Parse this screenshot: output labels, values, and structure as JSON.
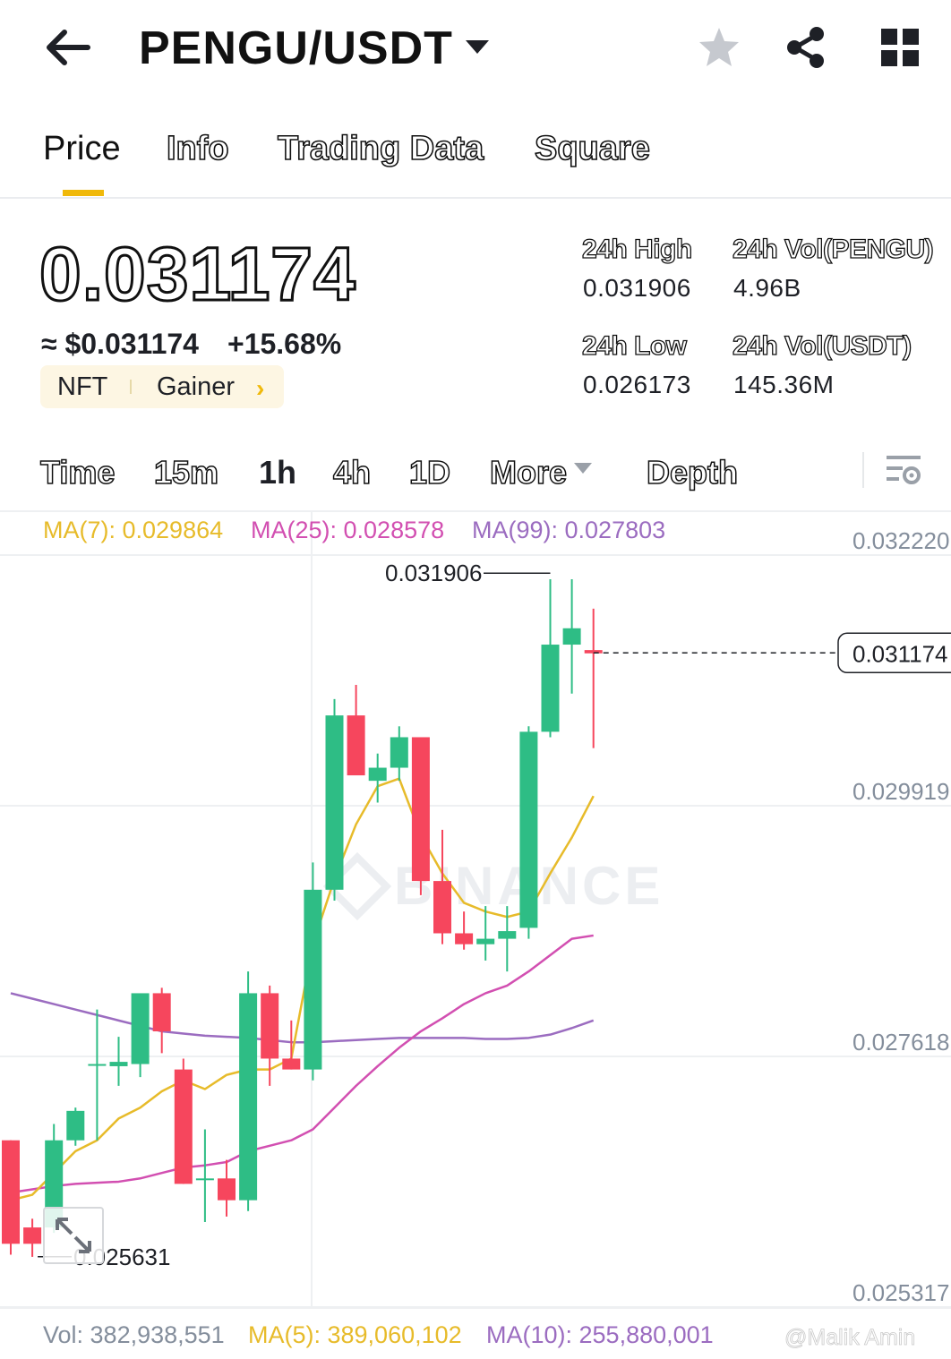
{
  "header": {
    "pair": "PENGU/USDT",
    "icons": [
      "back-arrow-icon",
      "caret-down-icon",
      "star-icon",
      "share-icon",
      "grid-icon"
    ]
  },
  "tabs": [
    {
      "label": "Price",
      "active": true
    },
    {
      "label": "Info",
      "active": false
    },
    {
      "label": "Trading Data",
      "active": false
    },
    {
      "label": "Square",
      "active": false
    }
  ],
  "price": {
    "last": "0.031174",
    "usd": "≈ $0.031174",
    "change": "+15.68%",
    "tags": {
      "first": "NFT",
      "second": "Gainer"
    }
  },
  "stats": {
    "high_label": "24h High",
    "high_value": "0.031906",
    "low_label": "24h Low",
    "low_value": "0.026173",
    "vol_base_label": "24h Vol(PENGU)",
    "vol_base_value": "4.96B",
    "vol_quote_label": "24h Vol(USDT)",
    "vol_quote_value": "145.36M"
  },
  "intervals": {
    "time": "Time",
    "m15": "15m",
    "h1": "1h",
    "h4": "4h",
    "d1": "1D",
    "more": "More",
    "depth": "Depth",
    "active": "1h"
  },
  "ma": {
    "ma7": "MA(7): 0.029864",
    "ma25": "MA(25): 0.028578",
    "ma99": "MA(99): 0.027803"
  },
  "chart_labels": {
    "y_ticks": [
      "0.032220",
      "0.029919",
      "0.027618",
      "0.025317"
    ],
    "current_price": "0.031174",
    "high_marker": "0.031906",
    "low_marker": "0.025631",
    "watermark": "BINANCE"
  },
  "volume": {
    "vol": "Vol: 382,938,551",
    "ma5": "MA(5): 389,060,102",
    "ma10": "MA(10): 255,880,001"
  },
  "credit": "@Malik Amin",
  "colors": {
    "accent": "#f0b90b",
    "up": "#2ebd85",
    "down": "#f6465d",
    "ma7": "#e7bb2a",
    "ma25": "#d24fb1",
    "ma99": "#9b6cc0",
    "axis_text": "#848e9c"
  },
  "chart_data": {
    "type": "candlestick",
    "interval": "1h",
    "y_range": [
      0.025317,
      0.03222
    ],
    "candles": [
      {
        "o": 0.0267,
        "h": 0.0267,
        "l": 0.02565,
        "c": 0.02575
      },
      {
        "o": 0.0259,
        "h": 0.02598,
        "l": 0.02563,
        "c": 0.02575
      },
      {
        "o": 0.0259,
        "h": 0.02685,
        "l": 0.02585,
        "c": 0.0267
      },
      {
        "o": 0.0267,
        "h": 0.027,
        "l": 0.02665,
        "c": 0.02697
      },
      {
        "o": 0.0274,
        "h": 0.0279,
        "l": 0.0267,
        "c": 0.0274
      },
      {
        "o": 0.02738,
        "h": 0.02765,
        "l": 0.0272,
        "c": 0.02742
      },
      {
        "o": 0.0274,
        "h": 0.02795,
        "l": 0.02728,
        "c": 0.02805
      },
      {
        "o": 0.02805,
        "h": 0.0281,
        "l": 0.0275,
        "c": 0.0277
      },
      {
        "o": 0.02735,
        "h": 0.02745,
        "l": 0.0263,
        "c": 0.0263
      },
      {
        "o": 0.02635,
        "h": 0.0268,
        "l": 0.02595,
        "c": 0.02635
      },
      {
        "o": 0.02635,
        "h": 0.02652,
        "l": 0.026,
        "c": 0.02615
      },
      {
        "o": 0.02615,
        "h": 0.02825,
        "l": 0.02605,
        "c": 0.02805
      },
      {
        "o": 0.02805,
        "h": 0.02812,
        "l": 0.0272,
        "c": 0.02745
      },
      {
        "o": 0.02745,
        "h": 0.0278,
        "l": 0.02735,
        "c": 0.02735
      },
      {
        "o": 0.02735,
        "h": 0.02925,
        "l": 0.02725,
        "c": 0.029
      },
      {
        "o": 0.029,
        "h": 0.03075,
        "l": 0.0289,
        "c": 0.0306
      },
      {
        "o": 0.0306,
        "h": 0.03088,
        "l": 0.0301,
        "c": 0.03005
      },
      {
        "o": 0.03,
        "h": 0.03025,
        "l": 0.0298,
        "c": 0.03012
      },
      {
        "o": 0.03012,
        "h": 0.0305,
        "l": 0.03,
        "c": 0.0304
      },
      {
        "o": 0.0304,
        "h": 0.0304,
        "l": 0.02895,
        "c": 0.02908
      },
      {
        "o": 0.02908,
        "h": 0.02955,
        "l": 0.0285,
        "c": 0.0286
      },
      {
        "o": 0.0286,
        "h": 0.0288,
        "l": 0.02845,
        "c": 0.0285
      },
      {
        "o": 0.0285,
        "h": 0.02885,
        "l": 0.02835,
        "c": 0.02855
      },
      {
        "o": 0.02855,
        "h": 0.02885,
        "l": 0.02825,
        "c": 0.02862
      },
      {
        "o": 0.02865,
        "h": 0.0305,
        "l": 0.02855,
        "c": 0.03045
      },
      {
        "o": 0.03045,
        "h": 0.03185,
        "l": 0.0304,
        "c": 0.03125
      },
      {
        "o": 0.03125,
        "h": 0.03185,
        "l": 0.0308,
        "c": 0.0314
      },
      {
        "o": 0.0312,
        "h": 0.03158,
        "l": 0.0303,
        "c": 0.03117
      }
    ],
    "ma7": [
      0.02615,
      0.0262,
      0.0264,
      0.0266,
      0.0267,
      0.0269,
      0.027,
      0.02715,
      0.02725,
      0.02717,
      0.0273,
      0.02735,
      0.02735,
      0.02745,
      0.0285,
      0.0291,
      0.0296,
      0.02995,
      0.03002,
      0.0295,
      0.02915,
      0.02888,
      0.0288,
      0.02875,
      0.0288,
      0.02915,
      0.02948,
      0.02986
    ],
    "ma25": [
      0.02622,
      0.02625,
      0.02628,
      0.0263,
      0.02631,
      0.02632,
      0.02635,
      0.0264,
      0.02645,
      0.02647,
      0.0265,
      0.0266,
      0.02665,
      0.0267,
      0.0268,
      0.027,
      0.0272,
      0.02738,
      0.02755,
      0.0277,
      0.02782,
      0.02795,
      0.02805,
      0.02812,
      0.02825,
      0.0284,
      0.02855,
      0.02858
    ],
    "ma99": [
      0.02805,
      0.028,
      0.02795,
      0.0279,
      0.02785,
      0.0278,
      0.02775,
      0.0277,
      0.02768,
      0.02766,
      0.02765,
      0.02764,
      0.02762,
      0.0276,
      0.0276,
      0.02761,
      0.02762,
      0.02763,
      0.02764,
      0.02764,
      0.02764,
      0.02764,
      0.02763,
      0.02763,
      0.02764,
      0.02767,
      0.02773,
      0.0278
    ]
  }
}
